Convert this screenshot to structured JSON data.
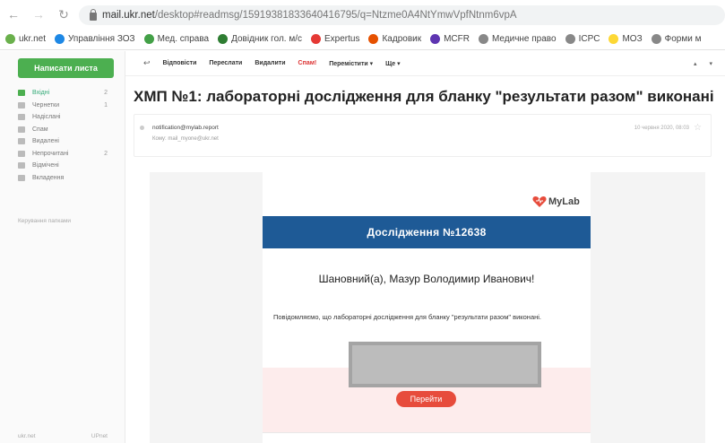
{
  "browser": {
    "back_icon": "arrow-left-icon",
    "forward_icon": "arrow-right-icon",
    "reload_icon": "reload-icon",
    "url_host": "mail.ukr.net",
    "url_path": "/desktop#readmsg/15919381833640416795/q=Ntzme0A4NtYmwVpfNtnm6vpA",
    "bookmarks": [
      {
        "label": "ukr.net",
        "color": "#6ab04c"
      },
      {
        "label": "Управління ЗОЗ",
        "color": "#1e88e5"
      },
      {
        "label": "Мед. справа",
        "color": "#43a047"
      },
      {
        "label": "Довідник гол. м/с",
        "color": "#2e7d32"
      },
      {
        "label": "Expertus",
        "color": "#e53935"
      },
      {
        "label": "Кадровик",
        "color": "#e65100"
      },
      {
        "label": "MCFR",
        "color": "#5e35b1"
      },
      {
        "label": "Медичне право",
        "color": "#888888"
      },
      {
        "label": "ICPC",
        "color": "#888888"
      },
      {
        "label": "МОЗ",
        "color": "#fdd835"
      },
      {
        "label": "Форми м",
        "color": "#888888"
      }
    ]
  },
  "sidebar": {
    "compose_label": "Написати листа",
    "folders": [
      {
        "label": "Вхідні",
        "count": "2",
        "icon": "inbox-icon",
        "active": true
      },
      {
        "label": "Чернетки",
        "count": "1",
        "icon": "draft-icon"
      },
      {
        "label": "Надіслані",
        "count": "",
        "icon": "sent-icon"
      },
      {
        "label": "Спам",
        "count": "",
        "icon": "spam-icon"
      },
      {
        "label": "Видалені",
        "count": "",
        "icon": "trash-icon"
      },
      {
        "label": "Непрочитані",
        "count": "2",
        "icon": "unread-icon"
      },
      {
        "label": "Відмічені",
        "count": "",
        "icon": "star-icon"
      },
      {
        "label": "Вкладення",
        "count": "",
        "icon": "attachment-icon"
      }
    ],
    "manage_label": "Керування папками",
    "footer_left": "ukr.net",
    "footer_right": "UPnet"
  },
  "toolbar": {
    "back_label": "↩",
    "reply": "Відповісти",
    "forward": "Переслати",
    "delete": "Видалити",
    "spam": "Спам!",
    "move": "Перемістити ▾",
    "more": "Ще ▾",
    "prev": "▴",
    "next": "▾"
  },
  "message": {
    "subject": "ХМП №1: лабораторні дослідження для бланку \"результати разом\" виконані",
    "from": "notification@mylab.report",
    "to": "Кому:  mail_myone@ukr.net",
    "date": "10 червня 2020, 08:03",
    "logo_text": "MyLab",
    "brand_color": "#e74c3c",
    "banner_title": "Дослідження №12638",
    "banner_color": "#1e5a96",
    "greeting": "Шановний(а), Мазур Володимир Иванович!",
    "body": "Повідомляємо, що лабораторні дослідження для бланку \"результати разом\" виконані.",
    "go_button": "Перейти"
  }
}
